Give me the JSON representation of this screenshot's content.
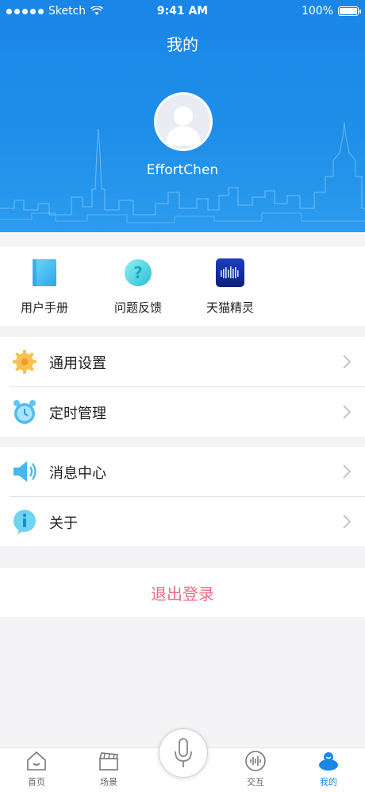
{
  "status_bar": {
    "carrier": "Sketch",
    "time": "9:41 AM",
    "battery": "100%"
  },
  "header": {
    "title": "我的",
    "username": "EffortChen"
  },
  "shortcuts": [
    {
      "label": "用户手册",
      "icon": "manual-book-icon"
    },
    {
      "label": "问题反馈",
      "icon": "question-feedback-icon"
    },
    {
      "label": "天猫精灵",
      "icon": "tmall-genie-icon"
    }
  ],
  "menu_group_1": [
    {
      "label": "通用设置",
      "icon": "gear-icon"
    },
    {
      "label": "定时管理",
      "icon": "alarm-clock-icon"
    }
  ],
  "menu_group_2": [
    {
      "label": "消息中心",
      "icon": "speaker-icon"
    },
    {
      "label": "关于",
      "icon": "info-icon"
    }
  ],
  "logout": {
    "label": "退出登录"
  },
  "tabbar": [
    {
      "label": "首页",
      "icon": "home-icon"
    },
    {
      "label": "场景",
      "icon": "clapperboard-icon"
    },
    {
      "label": "",
      "icon": "microphone-icon"
    },
    {
      "label": "交互",
      "icon": "voice-wave-icon"
    },
    {
      "label": "我的",
      "icon": "profile-icon",
      "active": true
    }
  ],
  "colors": {
    "primary": "#1a86e8",
    "logout": "#f06a83",
    "background": "#f4f4f6"
  }
}
